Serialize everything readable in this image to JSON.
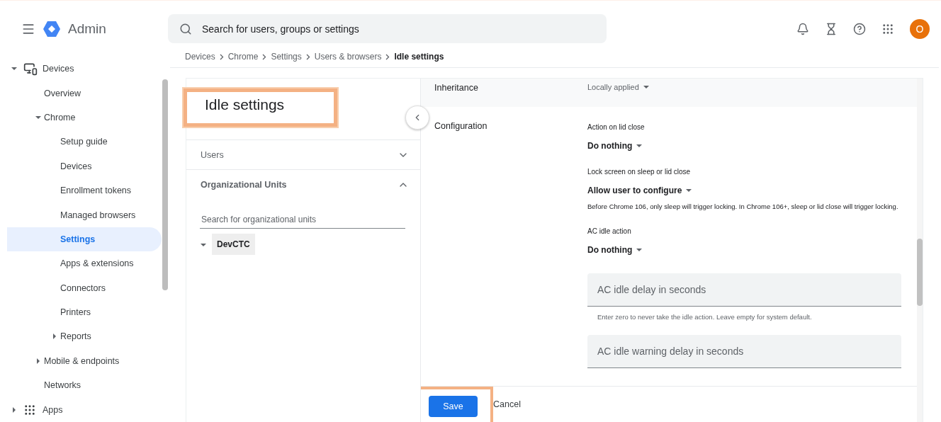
{
  "topbar": {
    "app_name": "Admin",
    "search": {
      "placeholder": "Search for users, groups or settings"
    },
    "avatar": "O"
  },
  "sidebar": {
    "items": [
      {
        "label": "Devices",
        "expanded": true,
        "selected": false,
        "children": [
          {
            "label": "Overview",
            "selected": false
          },
          {
            "label": "Chrome",
            "expanded": true,
            "selected": false,
            "children": [
              {
                "label": "Setup guide",
                "selected": false
              },
              {
                "label": "Devices",
                "selected": false
              },
              {
                "label": "Enrollment tokens",
                "selected": false
              },
              {
                "label": "Managed browsers",
                "selected": false
              },
              {
                "label": "Settings",
                "selected": true
              },
              {
                "label": "Apps & extensions",
                "selected": false
              },
              {
                "label": "Connectors",
                "selected": false
              },
              {
                "label": "Printers",
                "selected": false
              },
              {
                "label": "Reports",
                "expanded": false,
                "selected": false
              }
            ]
          },
          {
            "label": "Mobile & endpoints",
            "expanded": false,
            "selected": false
          },
          {
            "label": "Networks",
            "selected": false
          }
        ]
      },
      {
        "label": "Apps",
        "expanded": false,
        "selected": false
      }
    ]
  },
  "breadcrumb": [
    {
      "label": "Devices",
      "current": false
    },
    {
      "label": "Chrome",
      "current": false
    },
    {
      "label": "Settings",
      "current": false
    },
    {
      "label": "Users & browsers",
      "current": false
    },
    {
      "label": "Idle settings",
      "current": true
    }
  ],
  "left_panel": {
    "title": "Idle settings",
    "title_highlighted": true,
    "sections": [
      {
        "label": "Users",
        "expanded": false
      },
      {
        "label": "Organizational Units",
        "expanded": true
      }
    ],
    "search": {
      "placeholder": "Search for organizational units"
    },
    "tree": [
      {
        "label": "DevCTC",
        "expanded": true,
        "selected": true
      }
    ]
  },
  "settings": {
    "rows": [
      {
        "label": "Inheritance",
        "shaded": true,
        "items": [
          {
            "kind": "select",
            "value": "Locally applied",
            "muted": true
          }
        ]
      },
      {
        "label": "Configuration",
        "shaded": false,
        "items": [
          {
            "kind": "select",
            "label": "Action on lid close",
            "value": "Do nothing",
            "muted": false
          },
          {
            "kind": "select",
            "label": "Lock screen on sleep or lid close",
            "value": "Allow user to configure",
            "muted": false
          },
          {
            "kind": "note",
            "text": "Before Chrome 106, only sleep will trigger locking. In Chrome 106+, sleep or lid close will trigger locking."
          },
          {
            "kind": "select",
            "label": "AC idle action",
            "value": "Do nothing",
            "muted": false
          },
          {
            "kind": "field",
            "placeholder": "AC idle delay in seconds",
            "hint": "Enter zero to never take the idle action. Leave empty for system default."
          },
          {
            "kind": "field",
            "placeholder": "AC idle warning delay in seconds"
          }
        ]
      }
    ]
  },
  "footer": {
    "buttons": [
      {
        "label": "Save",
        "kind": "primary",
        "highlighted": true
      },
      {
        "label": "Cancel",
        "kind": "text",
        "highlighted": false
      }
    ]
  }
}
